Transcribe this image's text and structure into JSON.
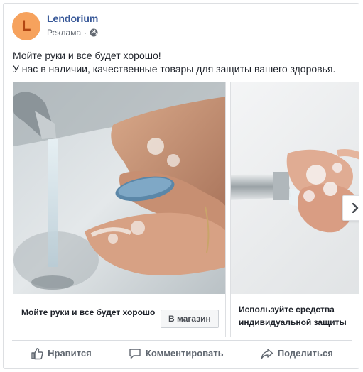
{
  "post": {
    "avatar_letter": "L",
    "page_name": "Lendorium",
    "sponsored_label": "Реклама",
    "separator": "·",
    "text_lines": [
      "Мойте руки и все будет хорошо!",
      "У нас в наличии, качественные товары для защиты вашего здоровья."
    ]
  },
  "carousel": {
    "cards": [
      {
        "title": "Мойте руки и все будет хорошо",
        "cta": "В магазин",
        "image": "hand-washing-sink-photo"
      },
      {
        "title": "Используйте средства индивидуальной защиты",
        "cta": "",
        "image": "hand-washing-faucet-photo"
      }
    ],
    "next_icon": "chevron-right-icon"
  },
  "actions": {
    "like": "Нравится",
    "comment": "Комментировать",
    "share": "Поделиться"
  },
  "colors": {
    "page_name": "#385898",
    "avatar_bg": "#f6a25d",
    "avatar_letter": "#b24612",
    "meta_text": "#616770",
    "action_text": "#606770"
  }
}
